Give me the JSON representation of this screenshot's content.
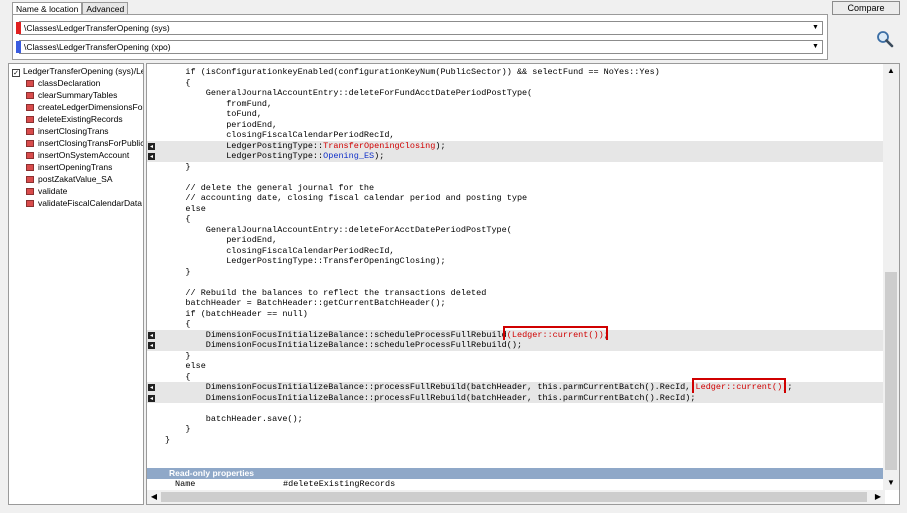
{
  "tabs": [
    "Name & location",
    "Advanced"
  ],
  "compare_label": "Compare",
  "paths": [
    {
      "value": "\\Classes\\LedgerTransferOpening (sys)",
      "color": "#e02020"
    },
    {
      "value": "\\Classes\\LedgerTransferOpening (xpo)",
      "color": "#3a5ce0"
    }
  ],
  "icons": {
    "search": "magnifier-icon",
    "method": "method-icon",
    "checkbox": "checkbox-icon",
    "dropdown": "chevron-down-icon",
    "change": "change-marker-icon"
  },
  "tree": {
    "root": "LedgerTransferOpening (sys)/Le",
    "items": [
      "classDeclaration",
      "clearSummaryTables",
      "createLedgerDimensionsForP",
      "deleteExistingRecords",
      "insertClosingTrans",
      "insertClosingTransForPublicS",
      "insertOnSystemAccount",
      "insertOpeningTrans",
      "postZakatValue_SA",
      "validate",
      "validateFiscalCalendarData"
    ]
  },
  "code": [
    {
      "parts": [
        {
          "t": "    if (isConfigurationkeyEnabled(configurationKeyNum(PublicSector)) && selectFund == NoYes::Yes)"
        }
      ]
    },
    {
      "parts": [
        {
          "t": "    {"
        }
      ]
    },
    {
      "parts": [
        {
          "t": "        GeneralJournalAccountEntry::deleteForFundAcctDatePeriodPostType("
        }
      ]
    },
    {
      "parts": [
        {
          "t": "            fromFund,"
        }
      ]
    },
    {
      "parts": [
        {
          "t": "            toFund,"
        }
      ]
    },
    {
      "parts": [
        {
          "t": "            periodEnd,"
        }
      ]
    },
    {
      "parts": [
        {
          "t": "            closingFiscalCalendarPeriodRecId,"
        }
      ]
    },
    {
      "hl": true,
      "parts": [
        {
          "t": "            LedgerPostingType::"
        },
        {
          "t": "TransferOpeningClosing",
          "c": "red"
        },
        {
          "t": ");"
        }
      ]
    },
    {
      "hl": true,
      "parts": [
        {
          "t": "            LedgerPostingType::"
        },
        {
          "t": "Opening_ES",
          "c": "blue"
        },
        {
          "t": ");"
        }
      ]
    },
    {
      "parts": [
        {
          "t": "    }"
        }
      ]
    },
    {
      "parts": [
        {
          "t": ""
        }
      ]
    },
    {
      "parts": [
        {
          "t": "    // delete the general journal for the"
        }
      ]
    },
    {
      "parts": [
        {
          "t": "    // accounting date, closing fiscal calendar period and posting type"
        }
      ]
    },
    {
      "parts": [
        {
          "t": "    else"
        }
      ]
    },
    {
      "parts": [
        {
          "t": "    {"
        }
      ]
    },
    {
      "parts": [
        {
          "t": "        GeneralJournalAccountEntry::deleteForAcctDatePeriodPostType("
        }
      ]
    },
    {
      "parts": [
        {
          "t": "            periodEnd,"
        }
      ]
    },
    {
      "parts": [
        {
          "t": "            closingFiscalCalendarPeriodRecId,"
        }
      ]
    },
    {
      "parts": [
        {
          "t": "            LedgerPostingType::TransferOpeningClosing);"
        }
      ]
    },
    {
      "parts": [
        {
          "t": "    }"
        }
      ]
    },
    {
      "parts": [
        {
          "t": ""
        }
      ]
    },
    {
      "parts": [
        {
          "t": "    // Rebuild the balances to reflect the transactions deleted"
        }
      ]
    },
    {
      "parts": [
        {
          "t": "    batchHeader = BatchHeader::getCurrentBatchHeader();"
        }
      ]
    },
    {
      "parts": [
        {
          "t": "    if (batchHeader == null)"
        }
      ]
    },
    {
      "parts": [
        {
          "t": "    {"
        }
      ]
    },
    {
      "hl": true,
      "parts": [
        {
          "t": "        DimensionFocusInitializeBalance::scheduleProcessFullRebuild"
        },
        {
          "t": "(Ledger::current())",
          "c": "boxed"
        },
        {
          "t": ";"
        }
      ]
    },
    {
      "hl": true,
      "parts": [
        {
          "t": "        DimensionFocusInitializeBalance::scheduleProcessFullRebuild();"
        }
      ]
    },
    {
      "parts": [
        {
          "t": "    }"
        }
      ]
    },
    {
      "parts": [
        {
          "t": "    else"
        }
      ]
    },
    {
      "parts": [
        {
          "t": "    {"
        }
      ]
    },
    {
      "hl": true,
      "parts": [
        {
          "t": "        DimensionFocusInitializeBalance::processFullRebuild(batchHeader, this.parmCurrentBatch().RecId, "
        },
        {
          "t": "Ledger::current()",
          "c": "boxed"
        },
        {
          "t": ");"
        }
      ]
    },
    {
      "hl": true,
      "parts": [
        {
          "t": "        DimensionFocusInitializeBalance::processFullRebuild(batchHeader, this.parmCurrentBatch().RecId);"
        }
      ]
    },
    {
      "parts": [
        {
          "t": ""
        }
      ]
    },
    {
      "parts": [
        {
          "t": "        batchHeader.save();"
        }
      ]
    },
    {
      "parts": [
        {
          "t": "    }"
        }
      ]
    },
    {
      "parts": [
        {
          "t": "}"
        }
      ]
    }
  ],
  "props": {
    "title": "Read-only properties",
    "name_key": "Name",
    "name_value": "#deleteExistingRecords"
  }
}
